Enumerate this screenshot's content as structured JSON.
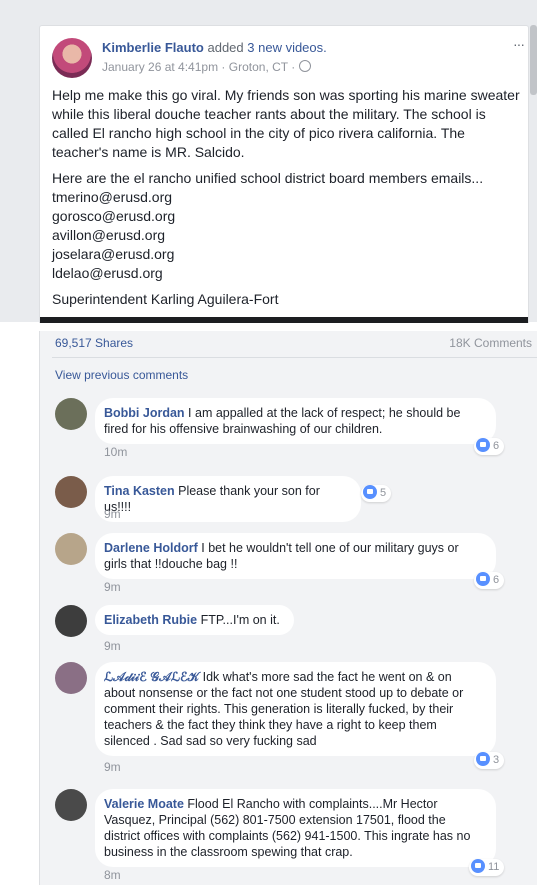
{
  "post": {
    "author": "Kimberlie Flauto",
    "action_prefix": "added",
    "action_link": "3 new videos.",
    "date": "January 26 at 4:41pm",
    "location": "Groton, CT",
    "more": "···",
    "paragraph1": "Help me make this go viral. My friends son was sporting his marine sweater while this liberal douche teacher rants about the military. The school is called El rancho high school in the city of pico rivera california. The teacher's name is MR. Salcido.",
    "paragraph2": "Here are the el rancho unified school district board members emails...",
    "emails": [
      "tmerino@erusd.org",
      "gorosco@erusd.org",
      "avillon@erusd.org",
      "joselara@erusd.org",
      "ldelao@erusd.org"
    ],
    "paragraph3": "Superintendent Karling Aguilera-Fort"
  },
  "stats": {
    "shares": "69,517 Shares",
    "comments": "18K Comments"
  },
  "view_previous": "View previous comments",
  "comments": [
    {
      "name": "Bobbi Jordan",
      "text": "I am appalled at the lack of respect; he should be fired for his offensive brainwashing of our children.",
      "time": "10m",
      "likes": "6",
      "avatar_color": "#6b6f5a"
    },
    {
      "name": "Tina Kasten",
      "text": "Please thank your son for us!!!!",
      "time": "9m",
      "likes": "5",
      "avatar_color": "#7a5c4a"
    },
    {
      "name": "Darlene Holdorf",
      "text": "I bet he wouldn't tell one of our military guys or girls that !!douche bag !!",
      "time": "9m",
      "likes": "6",
      "avatar_color": "#b7a58a"
    },
    {
      "name": "Elizabeth Rubie",
      "text": "FTP...I'm on it.",
      "time": "9m",
      "likes": "",
      "avatar_color": "#3d3d3d"
    },
    {
      "name": "ℒ𝒜𝒹𝒾𝒾ℰ 𝒢𝒜ℒℰ𝒦",
      "text": "Idk what's more sad the fact he went on & on about nonsense or the fact not one student stood up to debate or comment their rights. This generation is literally fucked, by their teachers & the fact they think they have a right to keep them silenced . Sad sad so very fucking sad",
      "time": "9m",
      "likes": "3",
      "avatar_color": "#8a6f85"
    },
    {
      "name": "Valerie Moate",
      "text": "Flood El Rancho with complaints....Mr Hector Vasquez, Principal (562) 801-7500 extension 17501, flood the district offices with complaints (562) 941-1500. This ingrate has no business in the classroom spewing that crap.",
      "time": "8m",
      "likes": "11",
      "avatar_color": "#4a4a4a"
    }
  ]
}
